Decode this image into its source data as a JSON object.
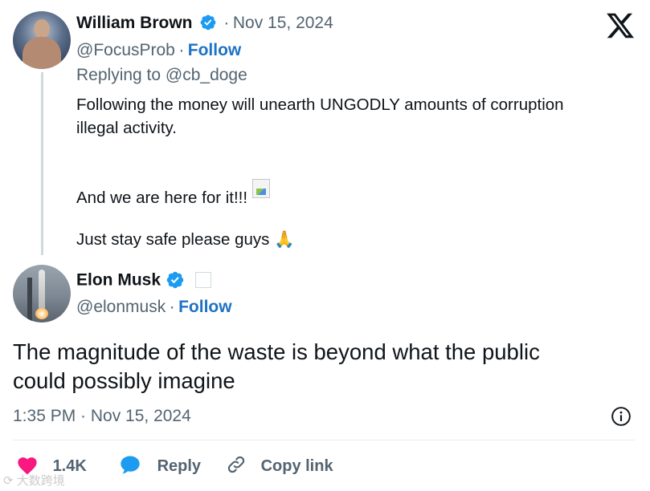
{
  "parent_tweet": {
    "display_name": "William Brown",
    "date": "Nov 15, 2024",
    "handle": "@FocusProb",
    "follow_label": "Follow",
    "replying_to": "Replying to @cb_doge",
    "text_line1": "Following the money will unearth UNGODLY amounts of corruption",
    "text_line2": "illegal activity.",
    "text_line3": "And we are here for it!!!",
    "text_line4": "Just stay safe please guys",
    "emoji": "🙏"
  },
  "main_tweet": {
    "display_name": "Elon Musk",
    "handle": "@elonmusk",
    "follow_label": "Follow",
    "text_line1": "The magnitude of the waste is beyond what the public",
    "text_line2": "could possibly imagine",
    "timestamp": "1:35 PM · Nov 15, 2024"
  },
  "actions": {
    "like_count": "1.4K",
    "reply_label": "Reply",
    "copy_link_label": "Copy link"
  },
  "separator": "·",
  "watermark": "大数跨境",
  "icons": {
    "verified": "verified-badge-icon",
    "x_logo": "x-logo-icon",
    "info": "info-icon",
    "heart": "heart-icon",
    "reply": "speech-bubble-icon",
    "link": "link-icon"
  },
  "colors": {
    "verified_blue": "#1d9bf0",
    "follow_blue": "#1d72c4",
    "heart_pink": "#f91880",
    "muted_gray": "#536471"
  }
}
